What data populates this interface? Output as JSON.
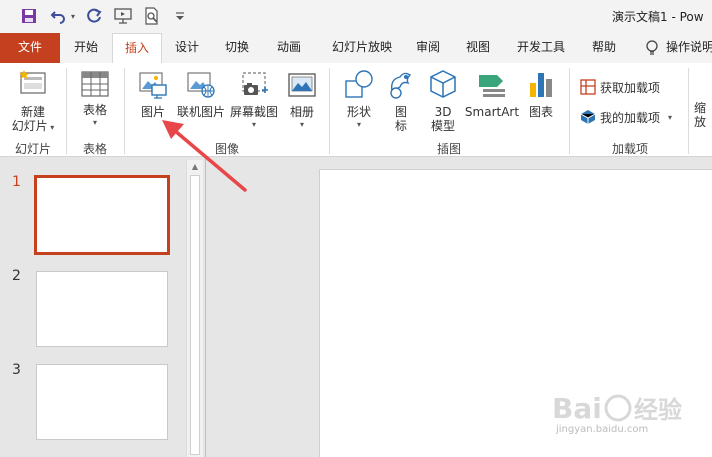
{
  "app": {
    "title": "演示文稿1  -  Pow"
  },
  "quick_access": {
    "icons": [
      "save-icon",
      "undo-icon",
      "redo-icon",
      "present-from-start-icon",
      "print-preview-icon",
      "customize-toolbar-icon"
    ]
  },
  "tabs": {
    "file": "文件",
    "items": [
      "开始",
      "插入",
      "设计",
      "切换",
      "动画",
      "幻灯片放映",
      "审阅",
      "视图",
      "开发工具",
      "帮助"
    ],
    "active": "插入",
    "tell_me": "操作说明"
  },
  "ribbon": {
    "groups": {
      "slides": "幻灯片",
      "tables": "表格",
      "images": "图像",
      "illustrations": "插图",
      "addins": "加载项"
    },
    "buttons": {
      "new_slide_1": "新建",
      "new_slide_2": "幻灯片",
      "table": "表格",
      "pictures": "图片",
      "online_pictures": "联机图片",
      "screenshot": "屏幕截图",
      "album": "相册",
      "shapes": "形状",
      "icons_1": "图",
      "icons_2": "标",
      "model_1": "3D",
      "model_2": "模型",
      "smartart": "SmartArt",
      "chart": "图表",
      "get_addins": "获取加载项",
      "my_addins": "我的加载项",
      "zoom_partial_1": "缩",
      "zoom_partial_2": "放"
    }
  },
  "slides_pane": {
    "numbers": [
      "1",
      "2",
      "3"
    ],
    "selected": "1"
  },
  "watermark": {
    "text": "jingyan.baidu.com"
  },
  "colors": {
    "accent": "#c5401f",
    "annotation_arrow": "#e8474a"
  }
}
